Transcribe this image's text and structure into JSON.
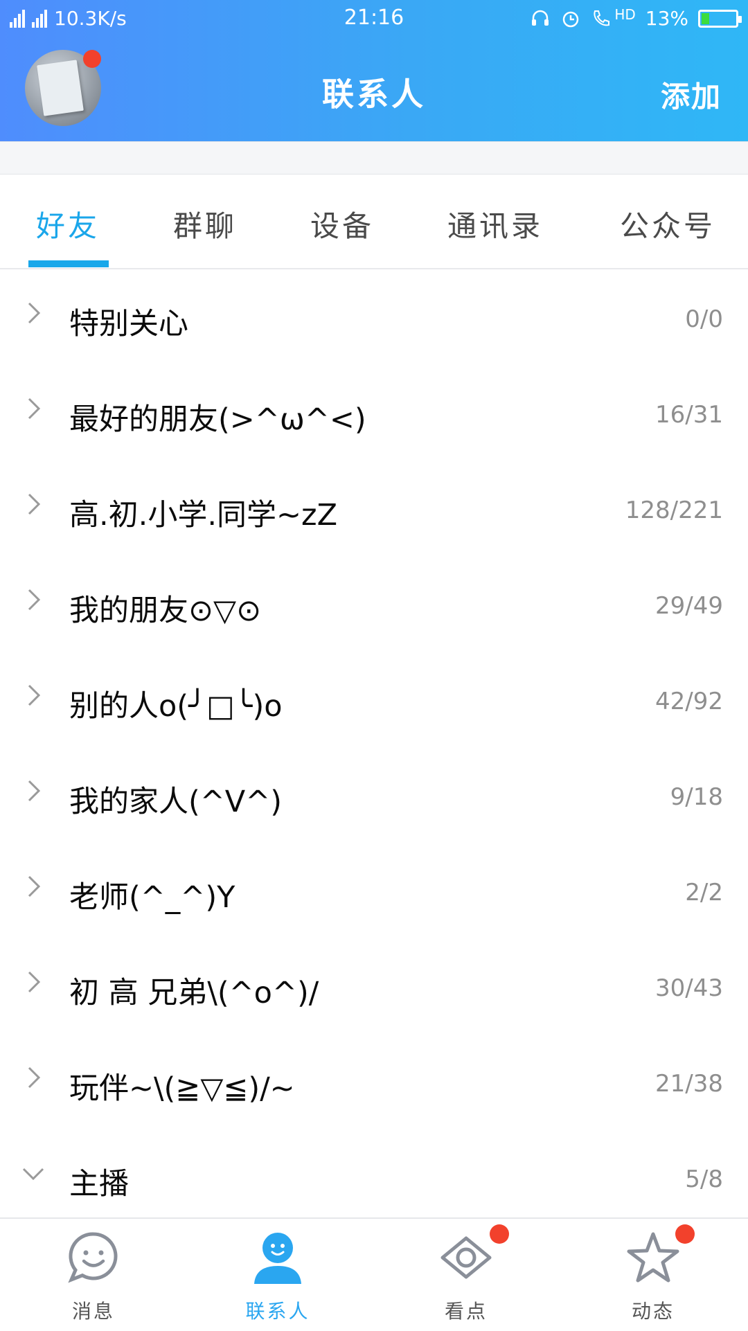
{
  "status_bar": {
    "network": "2G 4G 4G",
    "speed": "10.3K/s",
    "time": "21:16",
    "hd": "HD",
    "battery_pct": "13%"
  },
  "header": {
    "title": "联系人",
    "add_label": "添加"
  },
  "tabs": [
    {
      "label": "好友",
      "active": true
    },
    {
      "label": "群聊",
      "active": false
    },
    {
      "label": "设备",
      "active": false
    },
    {
      "label": "通讯录",
      "active": false
    },
    {
      "label": "公众号",
      "active": false
    }
  ],
  "groups": [
    {
      "name": "特别关心",
      "count": "0/0",
      "expanded": false
    },
    {
      "name": "最好的朋友(>^ω^<)",
      "count": "16/31",
      "expanded": false
    },
    {
      "name": "高.初.小学.同学~zZ",
      "count": "128/221",
      "expanded": false
    },
    {
      "name": "我的朋友⊙▽⊙",
      "count": "29/49",
      "expanded": false
    },
    {
      "name": "别的人o(╯□╰)o",
      "count": "42/92",
      "expanded": false
    },
    {
      "name": "我的家人(^V^)",
      "count": "9/18",
      "expanded": false
    },
    {
      "name": "老师(^_^)Y",
      "count": "2/2",
      "expanded": false
    },
    {
      "name": "初 高 兄弟\\(^o^)/",
      "count": "30/43",
      "expanded": false
    },
    {
      "name": "玩伴~\\(≧▽≦)/~",
      "count": "21/38",
      "expanded": false
    },
    {
      "name": "主播",
      "count": "5/8",
      "expanded": true
    }
  ],
  "bottom_nav": [
    {
      "label": "消息",
      "icon": "smile-bubble-icon",
      "active": false,
      "badge": false
    },
    {
      "label": "联系人",
      "icon": "person-icon",
      "active": true,
      "badge": false
    },
    {
      "label": "看点",
      "icon": "eye-icon",
      "active": false,
      "badge": true
    },
    {
      "label": "动态",
      "icon": "star-icon",
      "active": false,
      "badge": true
    }
  ],
  "colors": {
    "accent": "#19a7ea",
    "badge": "#f2412c",
    "header_start": "#4f8dfd",
    "header_end": "#2fb7f6"
  }
}
